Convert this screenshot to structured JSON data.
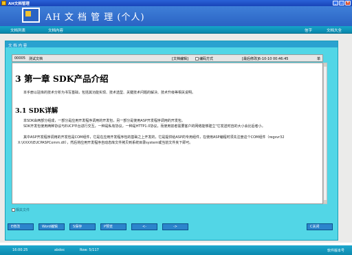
{
  "window": {
    "title": "AH文档管理"
  },
  "app": {
    "title": "AH 文 档 管 理 (个人)"
  },
  "menu": {
    "left": [
      "文档列表",
      "文档内容"
    ],
    "right": [
      "信字",
      "文档大全"
    ]
  },
  "panel": {
    "title": "文 档 内 容"
  },
  "doc_header": {
    "id": "00005",
    "name": "测试文档",
    "edit_link": "[文档编辑]",
    "checkbox_label": "编码方式",
    "modified": "[最后修改]6-10-10 00:46:45",
    "flag": "单"
  },
  "document": {
    "heading1": "3 第一章 SDK产品介绍",
    "intro": "本手册以驻库的技术分析为书写基础，包括其功能实现、技术选型、关键技术问题的解决、技术升级等相关说明。",
    "heading2": "3.1 SDK详解",
    "paragraphs": [
      "本SDK由两部分组成，一部分是应用开发程序调用的开发包，另一部分是使用ASP开发程序调用的开发包。",
      "SDK开发包使用两种协议与EUCP平台进行交互，一种是私有协议，一种是HTTP1.0协议，而使用前者需要客户的网络能够建立\"它发送时自的大小会比后者小。",
      "其中ASP开发程序调用的开发包是COM组件，它是在应用开发程序包的基础之上开发的，它是提供给ASP的专用组件，在使用ASP编程时须先注册这个COM组件（regsvr32 X:\\XXXX\\EUCPASPComm.dll），然后将应用开发程序自动态库文件拷贝到系统目录system或当前文件夹下即可。"
    ]
  },
  "below_doc": {
    "label": "相关文件"
  },
  "buttons": [
    "E修改",
    "Word编辑",
    "S保存",
    "P预览",
    "<-",
    "->",
    "C关闭"
  ],
  "status": {
    "time": "16:00:25",
    "user": "abdoc",
    "row": "Row: 5/117",
    "version": "软件版本号"
  }
}
